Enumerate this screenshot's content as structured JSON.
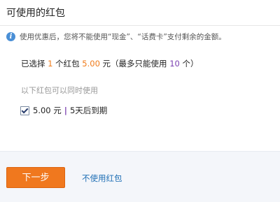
{
  "dialog": {
    "title": "可使用的红包"
  },
  "notice": {
    "icon": "info-icon",
    "text": "使用优惠后，您将不能使用“现金”、“话费卡”支付剩余的金额。"
  },
  "summary": {
    "prefix": "已选择 ",
    "count": "1",
    "count_suffix": " 个红包 ",
    "amount": "5.00",
    "amount_suffix": " 元（最多只能使用 ",
    "max": "10",
    "max_suffix": " 个）"
  },
  "hint": "以下红包可以同时使用",
  "vouchers": [
    {
      "checked": true,
      "amount_text": "5.00 元",
      "separator": "|",
      "expiry": "5天后到期"
    }
  ],
  "footer": {
    "next_label": "下一步",
    "skip_label": "不使用红包"
  },
  "colors": {
    "accent_orange": "#f07b1a",
    "link_blue": "#1f6fb5",
    "max_purple": "#7a3fb0",
    "info_blue": "#4a8fd6"
  }
}
